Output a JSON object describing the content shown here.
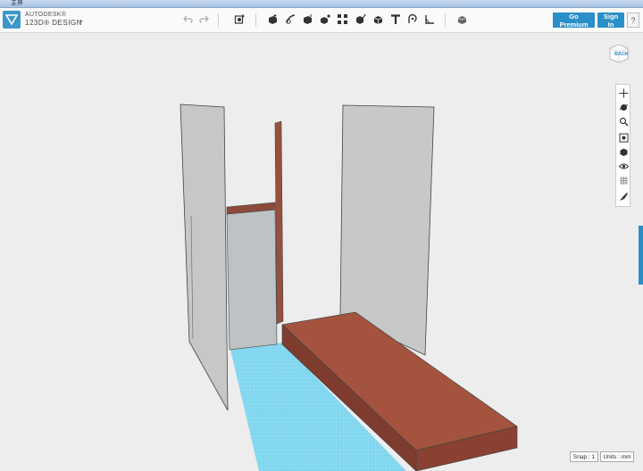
{
  "window": {
    "title": "主界"
  },
  "brand": {
    "line1": "AUTODESK®",
    "line2": "123D® DESIGN"
  },
  "toolbar": {
    "icons": [
      "undo-icon",
      "redo-icon",
      "primitives-icon",
      "sketch-icon",
      "construct-icon",
      "modify-icon",
      "pattern-icon",
      "grouping-icon",
      "combine-icon",
      "snap-icon",
      "text-icon",
      "measure-icon",
      "ruler-icon",
      "material-icon"
    ]
  },
  "account": {
    "premium_label": "Go Premium",
    "signin_label": "Sign In",
    "help_label": "?"
  },
  "viewcube": {
    "label": "BACK"
  },
  "navbar": {
    "icons": [
      "pan-icon",
      "orbit-icon",
      "zoom-icon",
      "fit-icon",
      "view-icon",
      "visibility-icon",
      "grid-icon",
      "material-icon"
    ]
  },
  "status": {
    "snap": "Snap : 1",
    "units": "Units : mm"
  },
  "colors": {
    "accent": "#2a8fc7",
    "wall": "#c8c9c9",
    "floor": "#7fd6ee",
    "wood": "#a0523f"
  }
}
